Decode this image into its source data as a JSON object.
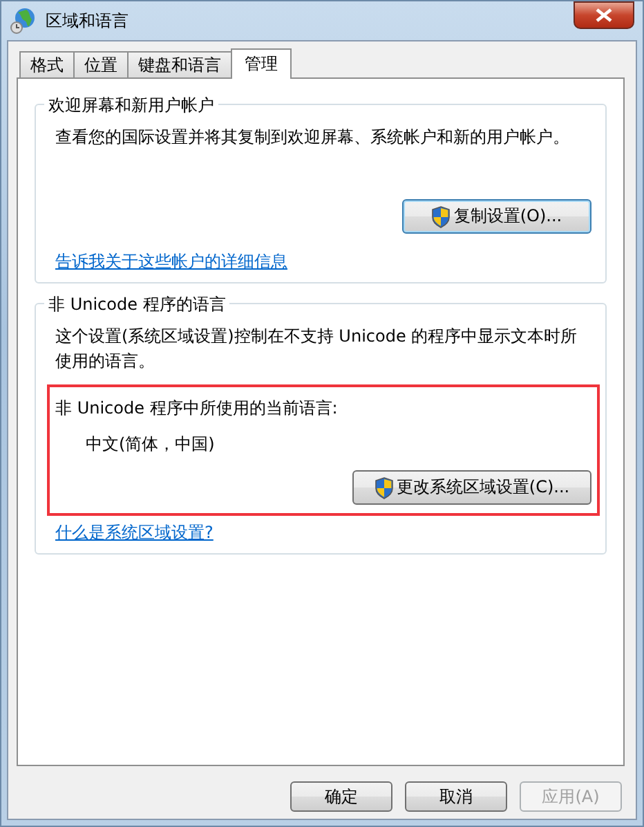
{
  "window": {
    "title": "区域和语言"
  },
  "tabs": [
    {
      "label": "格式",
      "selected": false
    },
    {
      "label": "位置",
      "selected": false
    },
    {
      "label": "键盘和语言",
      "selected": false
    },
    {
      "label": "管理",
      "selected": true
    }
  ],
  "welcome_group": {
    "title": "欢迎屏幕和新用户帐户",
    "description": "查看您的国际设置并将其复制到欢迎屏幕、系统帐户和新的用户帐户。",
    "button": "复制设置(O)...",
    "link": "告诉我关于这些帐户的详细信息"
  },
  "non_unicode_group": {
    "title": "非 Unicode 程序的语言",
    "description": "这个设置(系统区域设置)控制在不支持 Unicode 的程序中显示文本时所使用的语言。",
    "current_label": "非 Unicode 程序中所使用的当前语言:",
    "current_value": "中文(简体，中国)",
    "button": "更改系统区域设置(C)...",
    "link": "什么是系统区域设置?",
    "highlighted": true
  },
  "buttons": [
    {
      "label": "确定",
      "disabled": false
    },
    {
      "label": "取消",
      "disabled": false
    },
    {
      "label": "应用(A)",
      "disabled": true
    }
  ]
}
